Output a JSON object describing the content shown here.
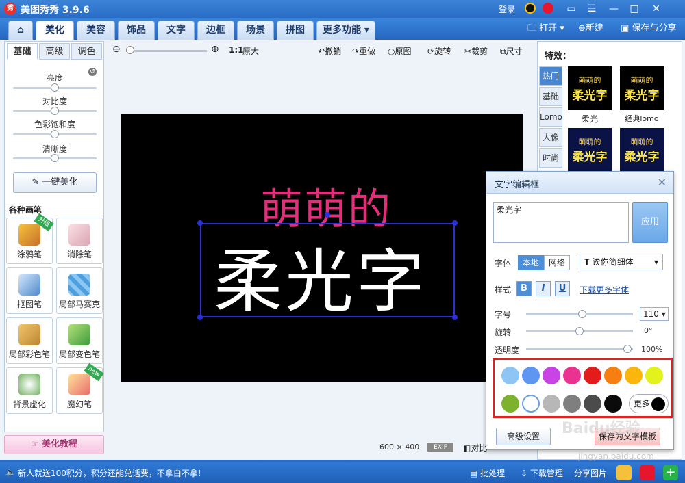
{
  "titlebar": {
    "app_name": "美图秀秀 3.9.6",
    "login": "登录",
    "logo_text": "秀"
  },
  "menu": {
    "tabs": [
      "美化",
      "美容",
      "饰品",
      "文字",
      "边框",
      "场景",
      "拼图",
      "更多功能"
    ],
    "open": "打开",
    "new": "新建",
    "save_share": "保存与分享"
  },
  "left": {
    "tabs": [
      "基础",
      "高级",
      "调色"
    ],
    "sliders": [
      "亮度",
      "对比度",
      "色彩饱和度",
      "清晰度"
    ],
    "slider_levels": [
      0.5,
      0.5,
      0.5,
      0.5
    ],
    "one_key": "一键美化",
    "brushes_title": "各种画笔",
    "brushes": [
      {
        "label": "涂鸦笔",
        "badge": "升级"
      },
      {
        "label": "消除笔",
        "badge": ""
      },
      {
        "label": "抠图笔",
        "badge": ""
      },
      {
        "label": "局部马赛克",
        "badge": ""
      },
      {
        "label": "局部彩色笔",
        "badge": ""
      },
      {
        "label": "局部变色笔",
        "badge": ""
      },
      {
        "label": "背景虚化",
        "badge": ""
      },
      {
        "label": "魔幻笔",
        "badge": "new"
      }
    ],
    "tutorial": "美化教程"
  },
  "toolbar": {
    "ratio": "1:1",
    "original_size": "原大",
    "undo": "撤销",
    "redo": "重做",
    "original": "原图",
    "rotate": "旋转",
    "crop": "裁剪",
    "size": "尺寸"
  },
  "canvas": {
    "sub_text": "萌萌的",
    "main_text": "柔光字"
  },
  "effects": {
    "title": "特效：",
    "tabs": [
      "热门",
      "基础",
      "Lomo",
      "人像",
      "时尚"
    ],
    "thumbs": [
      {
        "label": "柔光",
        "line1": "萌萌的",
        "line2": "柔光字"
      },
      {
        "label": "经典lomo",
        "line1": "萌萌的",
        "line2": "柔光字"
      },
      {
        "label": "",
        "line1": "萌萌的",
        "line2": "柔光字"
      },
      {
        "label": "",
        "line1": "萌萌的",
        "line2": "柔光字"
      }
    ]
  },
  "dialog": {
    "title": "文字编辑框",
    "text_value": "柔光字",
    "apply": "应用",
    "font_label": "字体",
    "font_local": "本地",
    "font_online": "网络",
    "font_name": "诶你简细体",
    "style_label": "样式",
    "bold": "B",
    "italic": "I",
    "underline": "U",
    "more_fonts": "下载更多字体",
    "size_label": "字号",
    "size_value": "110",
    "rotate_label": "旋转",
    "rotate_value": "0°",
    "opacity_label": "透明度",
    "opacity_value": "100%",
    "colors_row1": [
      "#8ec5f5",
      "#5f96f2",
      "#c944e4",
      "#ea3290",
      "#e21b1b",
      "#f77f12",
      "#fbb60c",
      "#e3f21c"
    ],
    "colors_row2": [
      "#7db22d",
      "#ffffff",
      "#b7b7b7",
      "#7f7f7f",
      "#4b4b4b",
      "#0b0b0b"
    ],
    "more_colors": "更多",
    "advanced": "高级设置",
    "save_text": "保存为文字模板"
  },
  "info": {
    "image_size": "600 × 400",
    "exif": "EXIF",
    "compare": "对比"
  },
  "status": {
    "message": "新人就送100积分，积分还能兑话费，不拿白不拿!",
    "batch": "批处理",
    "download": "下载管理",
    "share": "分享图片"
  },
  "watermark": {
    "text": "Baidu经验",
    "url": "jingyan.baidu.com"
  }
}
